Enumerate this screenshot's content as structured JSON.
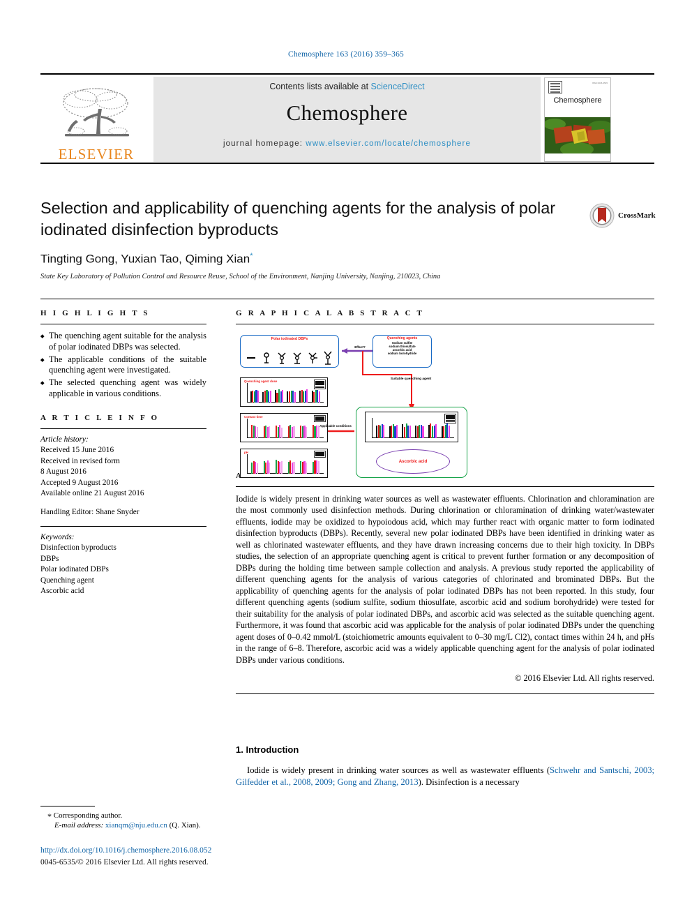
{
  "running_head": "Chemosphere 163 (2016) 359–365",
  "masthead": {
    "contents_prefix": "Contents lists available at ",
    "contents_link": "ScienceDirect",
    "journal_name": "Chemosphere",
    "homepage_prefix": "journal homepage: ",
    "homepage_url": "www.elsevier.com/locate/chemosphere",
    "publisher_logo_text": "ELSEVIER",
    "cover_title": "Chemosphere"
  },
  "article": {
    "title": "Selection and applicability of quenching agents for the analysis of polar iodinated disinfection byproducts",
    "authors": "Tingting Gong, Yuxian Tao, Qiming Xian",
    "corresponding_marker": "*",
    "affiliation": "State Key Laboratory of Pollution Control and Resource Reuse, School of the Environment, Nanjing University, Nanjing, 210023, China",
    "crossmark_label": "CrossMark"
  },
  "highlights": {
    "heading": "H I G H L I G H T S",
    "items": [
      "The quenching agent suitable for the analysis of polar iodinated DBPs was selected.",
      "The applicable conditions of the suitable quenching agent were investigated.",
      "The selected quenching agent was widely applicable in various conditions."
    ]
  },
  "graphical_abstract": {
    "heading": "G R A P H I C A L   A B S T R A C T",
    "box_polar_dbps": "Polar iodinated DBPs",
    "box_quenching_agents_title": "Quenching agents",
    "box_quenching_agents_list": "Sodium sulfite\nsodium thiosulfate\nascorbic acid\nsodium borohydride",
    "arrow_effect": "Effect?",
    "arrow_suitable": "Suitable quenching agent",
    "arrow_applicable": "Applicable conditions",
    "chart1_title": "Quenching agent dose",
    "chart2_title": "Contact time",
    "chart3_title": "pH",
    "result_label": "Ascorbic acid"
  },
  "article_info": {
    "heading": "A R T I C L E   I N F O",
    "history_label": "Article history:",
    "history": [
      "Received 15 June 2016",
      "Received in revised form",
      "8 August 2016",
      "Accepted 9 August 2016",
      "Available online 21 August 2016"
    ],
    "handling_editor": "Handling Editor: Shane Snyder",
    "keywords_label": "Keywords:",
    "keywords": [
      "Disinfection byproducts",
      "DBPs",
      "Polar iodinated DBPs",
      "Quenching agent",
      "Ascorbic acid"
    ]
  },
  "abstract": {
    "heading": "A B S T R A C T",
    "body": "Iodide is widely present in drinking water sources as well as wastewater effluents. Chlorination and chloramination are the most commonly used disinfection methods. During chlorination or chloramination of drinking water/wastewater effluents, iodide may be oxidized to hypoiodous acid, which may further react with organic matter to form iodinated disinfection byproducts (DBPs). Recently, several new polar iodinated DBPs have been identified in drinking water as well as chlorinated wastewater effluents, and they have drawn increasing concerns due to their high toxicity. In DBPs studies, the selection of an appropriate quenching agent is critical to prevent further formation or any decomposition of DBPs during the holding time between sample collection and analysis. A previous study reported the applicability of different quenching agents for the analysis of various categories of chlorinated and brominated DBPs. But the applicability of quenching agents for the analysis of polar iodinated DBPs has not been reported. In this study, four different quenching agents (sodium sulfite, sodium thiosulfate, ascorbic acid and sodium borohydride) were tested for their suitability for the analysis of polar iodinated DBPs, and ascorbic acid was selected as the suitable quenching agent. Furthermore, it was found that ascorbic acid was applicable for the analysis of polar iodinated DBPs under the quenching agent doses of 0–0.42 mmol/L (stoichiometric amounts equivalent to 0–30 mg/L Cl2), contact times within 24 h, and pHs in the range of 6–8. Therefore, ascorbic acid was a widely applicable quenching agent for the analysis of polar iodinated DBPs under various conditions.",
    "copyright": "© 2016 Elsevier Ltd. All rights reserved."
  },
  "introduction": {
    "heading": "1. Introduction",
    "paragraph_part1": "Iodide is widely present in drinking water sources as well as wastewater effluents (",
    "citation": "Schwehr and Santschi, 2003; Gilfedder et al., 2008, 2009; Gong and Zhang, 2013",
    "paragraph_part2": "). Disinfection is a necessary"
  },
  "footer": {
    "corresponding_star": "*",
    "corresponding_text": "Corresponding author.",
    "email_label": "E-mail address:",
    "email": "xianqm@nju.edu.cn",
    "email_owner": "(Q. Xian).",
    "doi": "http://dx.doi.org/10.1016/j.chemosphere.2016.08.052",
    "issn_line": "0045-6535/© 2016 Elsevier Ltd. All rights reserved."
  },
  "colors": {
    "link": "#1265a8",
    "sciencedirect": "#2e8fc4",
    "elsevier_orange": "#e8861e",
    "ga_red": "#ee1c1c",
    "ga_blue": "#1668c4",
    "ga_green": "#17a349",
    "ga_purple": "#7a3fb0"
  }
}
